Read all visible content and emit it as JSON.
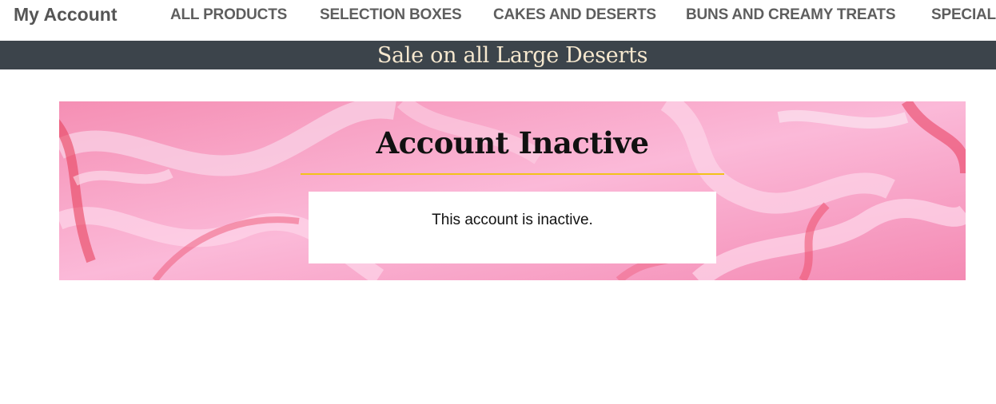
{
  "header": {
    "brand": "My Account",
    "nav": [
      {
        "label": "ALL PRODUCTS"
      },
      {
        "label": "SELECTION BOXES"
      },
      {
        "label": "CAKES AND DESERTS"
      },
      {
        "label": "BUNS AND CREAMY TREATS"
      },
      {
        "label": "SPECIAL"
      }
    ]
  },
  "banner": {
    "text": "Sale on all Large Deserts"
  },
  "hero": {
    "title": "Account Inactive",
    "message": "This account is inactive."
  },
  "colors": {
    "banner_bg": "#3c444b",
    "banner_text": "#f6e8cf",
    "rule": "#f2c21a",
    "hero_pink": "#f7a8c8"
  }
}
